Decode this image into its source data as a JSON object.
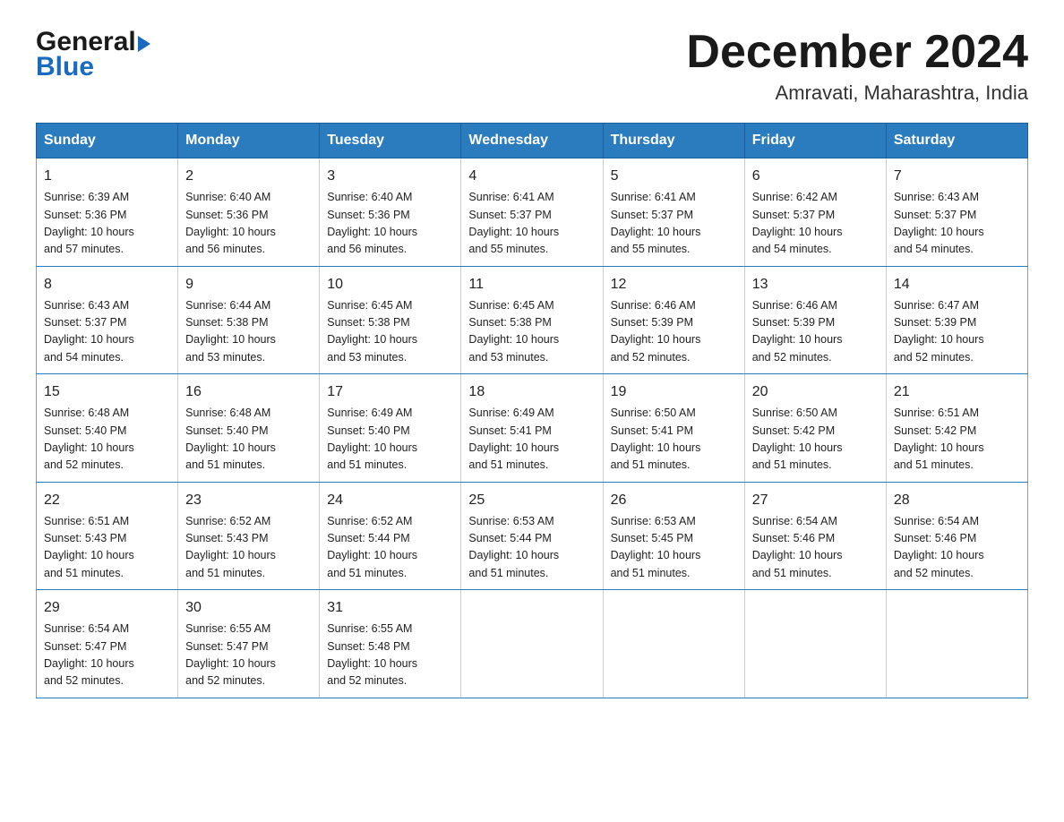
{
  "header": {
    "logo_general": "General",
    "logo_blue": "Blue",
    "title": "December 2024",
    "subtitle": "Amravati, Maharashtra, India"
  },
  "weekdays": [
    "Sunday",
    "Monday",
    "Tuesday",
    "Wednesday",
    "Thursday",
    "Friday",
    "Saturday"
  ],
  "weeks": [
    [
      {
        "day": "1",
        "sunrise": "6:39 AM",
        "sunset": "5:36 PM",
        "daylight": "10 hours and 57 minutes."
      },
      {
        "day": "2",
        "sunrise": "6:40 AM",
        "sunset": "5:36 PM",
        "daylight": "10 hours and 56 minutes."
      },
      {
        "day": "3",
        "sunrise": "6:40 AM",
        "sunset": "5:36 PM",
        "daylight": "10 hours and 56 minutes."
      },
      {
        "day": "4",
        "sunrise": "6:41 AM",
        "sunset": "5:37 PM",
        "daylight": "10 hours and 55 minutes."
      },
      {
        "day": "5",
        "sunrise": "6:41 AM",
        "sunset": "5:37 PM",
        "daylight": "10 hours and 55 minutes."
      },
      {
        "day": "6",
        "sunrise": "6:42 AM",
        "sunset": "5:37 PM",
        "daylight": "10 hours and 54 minutes."
      },
      {
        "day": "7",
        "sunrise": "6:43 AM",
        "sunset": "5:37 PM",
        "daylight": "10 hours and 54 minutes."
      }
    ],
    [
      {
        "day": "8",
        "sunrise": "6:43 AM",
        "sunset": "5:37 PM",
        "daylight": "10 hours and 54 minutes."
      },
      {
        "day": "9",
        "sunrise": "6:44 AM",
        "sunset": "5:38 PM",
        "daylight": "10 hours and 53 minutes."
      },
      {
        "day": "10",
        "sunrise": "6:45 AM",
        "sunset": "5:38 PM",
        "daylight": "10 hours and 53 minutes."
      },
      {
        "day": "11",
        "sunrise": "6:45 AM",
        "sunset": "5:38 PM",
        "daylight": "10 hours and 53 minutes."
      },
      {
        "day": "12",
        "sunrise": "6:46 AM",
        "sunset": "5:39 PM",
        "daylight": "10 hours and 52 minutes."
      },
      {
        "day": "13",
        "sunrise": "6:46 AM",
        "sunset": "5:39 PM",
        "daylight": "10 hours and 52 minutes."
      },
      {
        "day": "14",
        "sunrise": "6:47 AM",
        "sunset": "5:39 PM",
        "daylight": "10 hours and 52 minutes."
      }
    ],
    [
      {
        "day": "15",
        "sunrise": "6:48 AM",
        "sunset": "5:40 PM",
        "daylight": "10 hours and 52 minutes."
      },
      {
        "day": "16",
        "sunrise": "6:48 AM",
        "sunset": "5:40 PM",
        "daylight": "10 hours and 51 minutes."
      },
      {
        "day": "17",
        "sunrise": "6:49 AM",
        "sunset": "5:40 PM",
        "daylight": "10 hours and 51 minutes."
      },
      {
        "day": "18",
        "sunrise": "6:49 AM",
        "sunset": "5:41 PM",
        "daylight": "10 hours and 51 minutes."
      },
      {
        "day": "19",
        "sunrise": "6:50 AM",
        "sunset": "5:41 PM",
        "daylight": "10 hours and 51 minutes."
      },
      {
        "day": "20",
        "sunrise": "6:50 AM",
        "sunset": "5:42 PM",
        "daylight": "10 hours and 51 minutes."
      },
      {
        "day": "21",
        "sunrise": "6:51 AM",
        "sunset": "5:42 PM",
        "daylight": "10 hours and 51 minutes."
      }
    ],
    [
      {
        "day": "22",
        "sunrise": "6:51 AM",
        "sunset": "5:43 PM",
        "daylight": "10 hours and 51 minutes."
      },
      {
        "day": "23",
        "sunrise": "6:52 AM",
        "sunset": "5:43 PM",
        "daylight": "10 hours and 51 minutes."
      },
      {
        "day": "24",
        "sunrise": "6:52 AM",
        "sunset": "5:44 PM",
        "daylight": "10 hours and 51 minutes."
      },
      {
        "day": "25",
        "sunrise": "6:53 AM",
        "sunset": "5:44 PM",
        "daylight": "10 hours and 51 minutes."
      },
      {
        "day": "26",
        "sunrise": "6:53 AM",
        "sunset": "5:45 PM",
        "daylight": "10 hours and 51 minutes."
      },
      {
        "day": "27",
        "sunrise": "6:54 AM",
        "sunset": "5:46 PM",
        "daylight": "10 hours and 51 minutes."
      },
      {
        "day": "28",
        "sunrise": "6:54 AM",
        "sunset": "5:46 PM",
        "daylight": "10 hours and 52 minutes."
      }
    ],
    [
      {
        "day": "29",
        "sunrise": "6:54 AM",
        "sunset": "5:47 PM",
        "daylight": "10 hours and 52 minutes."
      },
      {
        "day": "30",
        "sunrise": "6:55 AM",
        "sunset": "5:47 PM",
        "daylight": "10 hours and 52 minutes."
      },
      {
        "day": "31",
        "sunrise": "6:55 AM",
        "sunset": "5:48 PM",
        "daylight": "10 hours and 52 minutes."
      },
      null,
      null,
      null,
      null
    ]
  ],
  "labels": {
    "sunrise": "Sunrise:",
    "sunset": "Sunset:",
    "daylight": "Daylight:"
  },
  "colors": {
    "header_bg": "#2b7bbf",
    "header_text": "#ffffff",
    "border": "#2b7bbf"
  }
}
